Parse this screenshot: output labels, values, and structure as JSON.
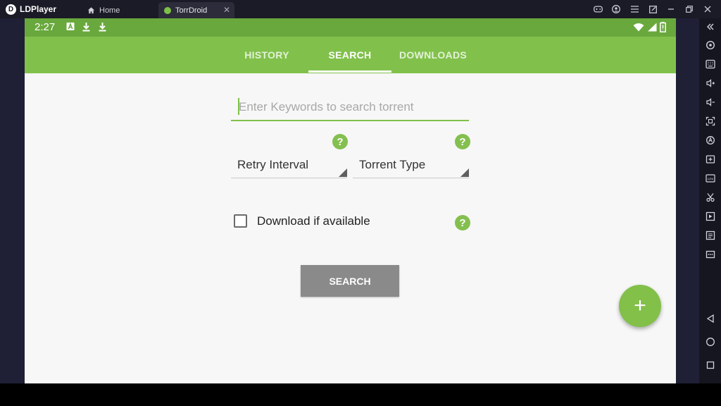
{
  "emulator": {
    "brand": "LDPlayer",
    "tabs": [
      {
        "label": "Home",
        "icon": "home-icon"
      },
      {
        "label": "TorrDroid",
        "icon": "app-icon"
      }
    ],
    "window_controls": [
      "gamepad-icon",
      "account-icon",
      "menu-icon",
      "popout-icon",
      "minimize-icon",
      "restore-icon",
      "close-icon"
    ],
    "sidebar_tools": [
      "settings-icon",
      "keyboard-icon",
      "volume-up-icon",
      "volume-down-icon",
      "fullscreen-icon",
      "sync-icon",
      "add-screen-icon",
      "apk-icon",
      "scissors-icon",
      "record-icon",
      "multi-instance-icon",
      "more-icon"
    ],
    "nav_buttons": [
      "back-icon",
      "home-circle-icon",
      "recents-icon"
    ]
  },
  "android": {
    "status_time": "2:27",
    "status_icons": [
      "a-icon",
      "download-icon",
      "download-icon"
    ],
    "status_right": [
      "wifi-icon",
      "signal-icon",
      "battery-icon"
    ]
  },
  "app": {
    "accent_color": "#81c14b",
    "tabs": [
      "HISTORY",
      "SEARCH",
      "DOWNLOADS"
    ],
    "active_tab": "SEARCH",
    "search": {
      "placeholder": "Enter Keywords to search torrent",
      "value": ""
    },
    "retry_interval_label": "Retry Interval",
    "torrent_type_label": "Torrent Type",
    "download_if_available_label": "Download if available",
    "download_if_available_checked": false,
    "help_glyph": "?",
    "search_button_label": "SEARCH",
    "fab_glyph": "+"
  }
}
